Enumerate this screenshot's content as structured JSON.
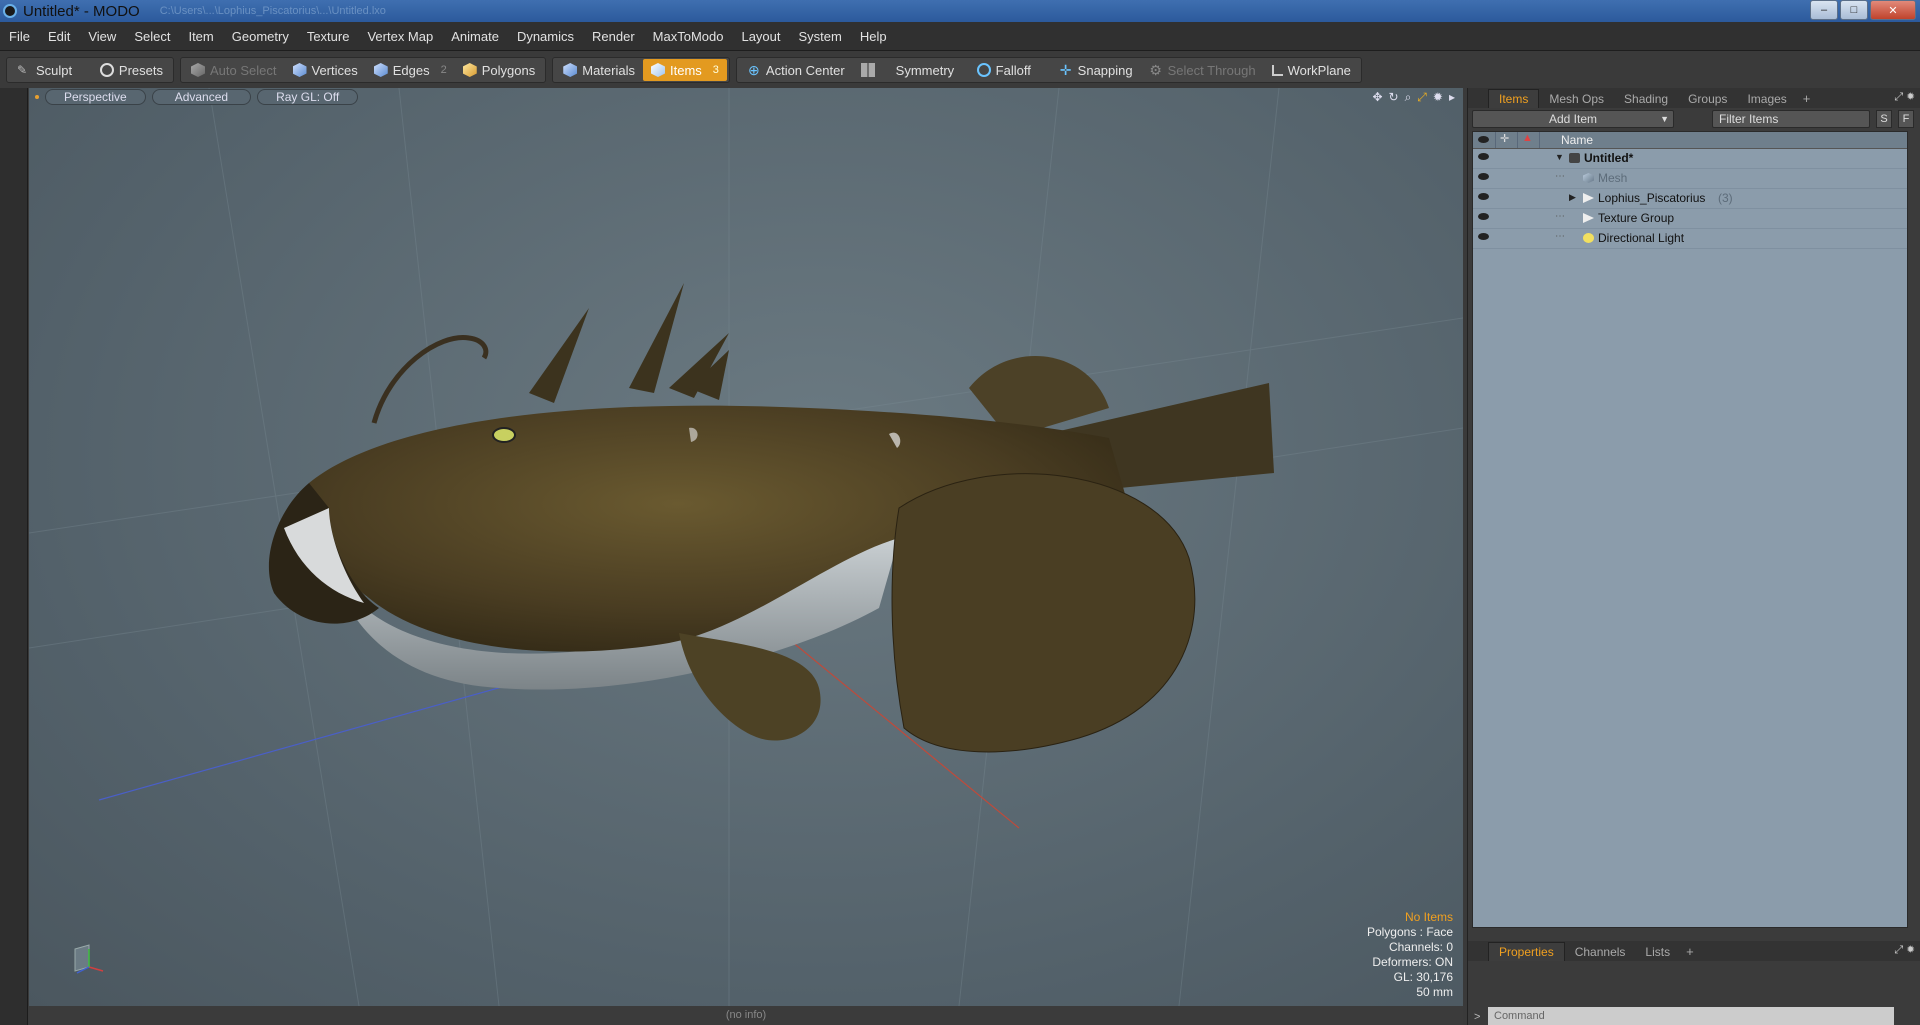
{
  "window": {
    "title": "Untitled* - MODO",
    "blurred_path": "C:\\Users\\...\\Lophius_Piscatorius\\...\\Untitled.lxo",
    "controls": [
      "–",
      "□",
      "✕"
    ]
  },
  "menu": [
    "File",
    "Edit",
    "View",
    "Select",
    "Item",
    "Geometry",
    "Texture",
    "Vertex Map",
    "Animate",
    "Dynamics",
    "Render",
    "MaxToModo",
    "Layout",
    "System",
    "Help"
  ],
  "toolbar": {
    "sculpt": "Sculpt",
    "presets": "Presets",
    "auto_select": "Auto Select",
    "vertices": "Vertices",
    "edges": "Edges",
    "edges_count": "2",
    "polygons": "Polygons",
    "materials": "Materials",
    "items": "Items",
    "items_count": "3",
    "action_center": "Action Center",
    "symmetry": "Symmetry",
    "falloff": "Falloff",
    "snapping": "Snapping",
    "select_through": "Select Through",
    "workplane": "WorkPlane"
  },
  "viewport": {
    "view": "Perspective",
    "mode": "Advanced",
    "raygl": "Ray GL: Off",
    "info": {
      "selection": "No Items",
      "polygons": "Polygons : Face",
      "channels": "Channels: 0",
      "deformers": "Deformers: ON",
      "gl": "GL: 30,176",
      "lens": "50 mm"
    },
    "status": "(no info)"
  },
  "panel": {
    "tabs": [
      "Items",
      "Mesh Ops",
      "Shading",
      "Groups",
      "Images"
    ],
    "add_item": "Add Item",
    "filter_placeholder": "Filter Items",
    "btn_s": "S",
    "btn_f": "F",
    "name_header": "Name",
    "tree": [
      {
        "label": "Untitled*",
        "type": "scene"
      },
      {
        "label": "Mesh",
        "type": "mesh"
      },
      {
        "label": "Lophius_Piscatorius",
        "count": "(3)",
        "type": "group"
      },
      {
        "label": "Texture Group",
        "type": "group"
      },
      {
        "label": "Directional Light",
        "type": "light"
      }
    ],
    "bottom_tabs": [
      "Properties",
      "Channels",
      "Lists"
    ],
    "command_placeholder": "Command"
  },
  "colors": {
    "accent": "#e39a20",
    "viewport_bg": "#5b6a73",
    "tree_bg": "#8b9cab"
  }
}
